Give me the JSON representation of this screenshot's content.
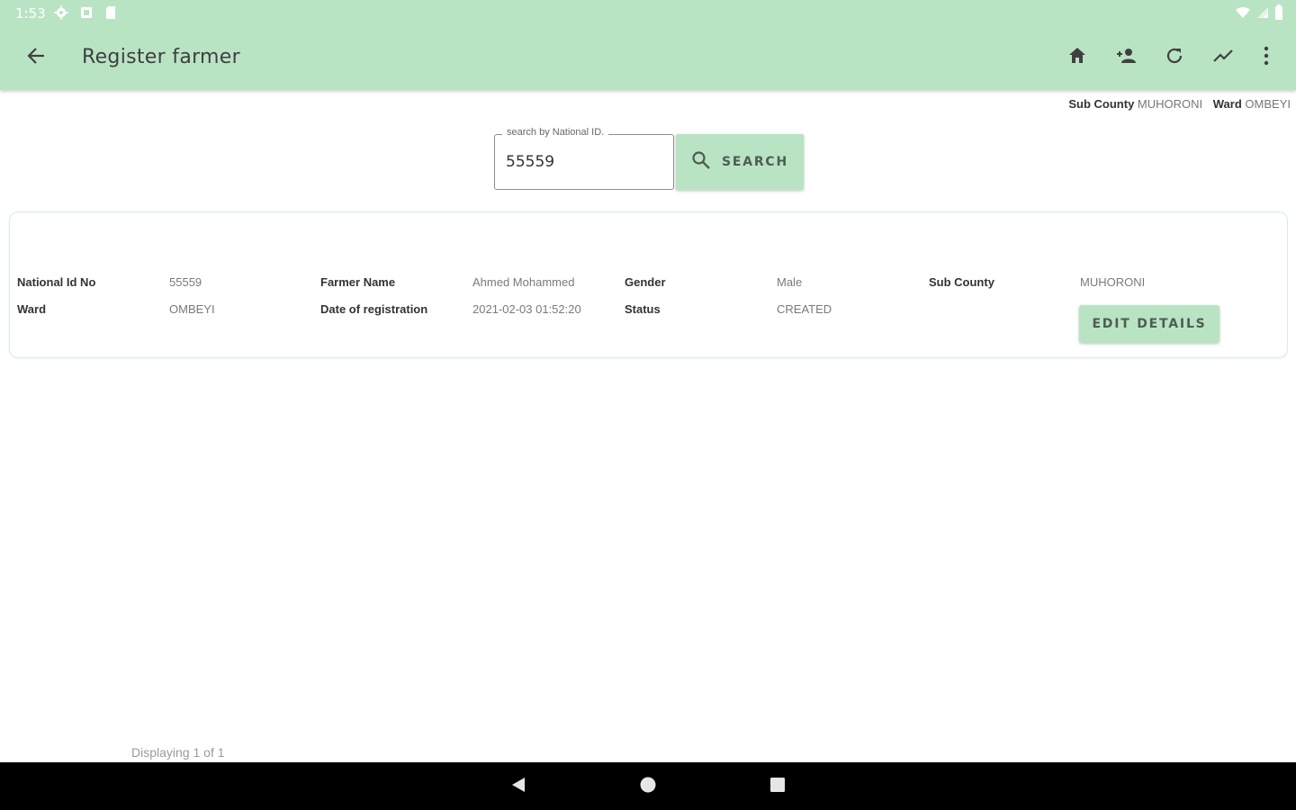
{
  "status_bar": {
    "time": "1:53",
    "icons_left": [
      "settings-icon",
      "sim-icon",
      "sd-card-icon"
    ],
    "icons_right": [
      "wifi-icon",
      "signal-icon",
      "battery-icon"
    ]
  },
  "app_bar": {
    "title": "Register farmer",
    "back_icon": "arrow-back-icon",
    "actions": [
      "home-icon",
      "add-person-icon",
      "refresh-icon",
      "trending-icon",
      "more-vert-icon"
    ],
    "background_color": "#b9e4c4"
  },
  "location": {
    "sub_county_label": "Sub County",
    "sub_county_value": "MUHORONI",
    "ward_label": "Ward",
    "ward_value": "OMBEYI"
  },
  "search": {
    "label": "search by National ID.",
    "value": "55559",
    "button_label": "SEARCH",
    "button_icon": "search-icon"
  },
  "farmer_card": {
    "national_id_label": "National Id No",
    "national_id_value": "55559",
    "farmer_name_label": "Farmer Name",
    "farmer_name_value": "Ahmed Mohammed",
    "gender_label": "Gender",
    "gender_value": "Male",
    "sub_county_label": "Sub County",
    "sub_county_value": "MUHORONI",
    "ward_label": "Ward",
    "ward_value": "OMBEYI",
    "date_label": "Date of registration",
    "date_value": "2021-02-03 01:52:20",
    "status_label": "Status",
    "status_value": "CREATED",
    "edit_button_label": "EDIT DETAILS"
  },
  "pager": {
    "text": "Displaying 1 of 1"
  },
  "nav_bar": {
    "buttons": [
      "back-triangle-icon",
      "home-circle-icon",
      "recents-square-icon"
    ]
  }
}
